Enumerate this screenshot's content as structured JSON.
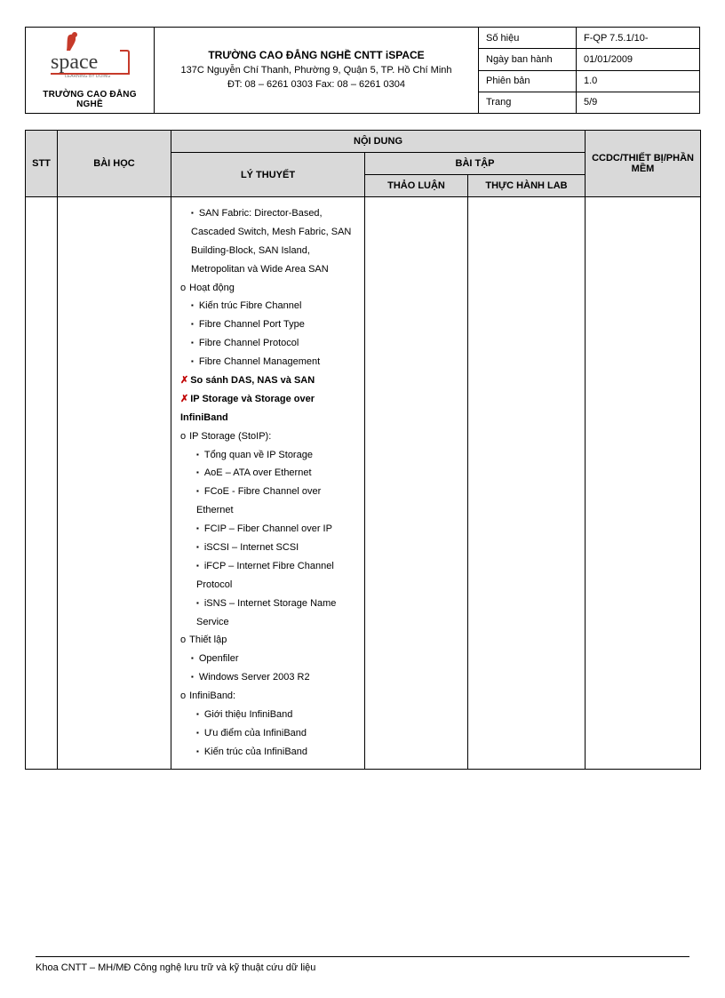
{
  "logo": {
    "word": "space",
    "subtitle": "TRƯỜNG CAO ĐẲNG NGHỀ"
  },
  "header": {
    "title": "TRƯỜNG CAO ĐẲNG NGHỀ CNTT iSPACE",
    "address": "137C Nguyễn Chí Thanh, Phường 9, Quận 5, TP. Hồ Chí Minh",
    "contact": "ĐT: 08 – 6261 0303    Fax: 08 – 6261 0304"
  },
  "info": {
    "sohieu_label": "Số hiệu",
    "sohieu_val": "F-QP 7.5.1/10-",
    "ngay_label": "Ngày ban hành",
    "ngay_val": "01/01/2009",
    "phienban_label": "Phiên bản",
    "phienban_val": "1.0",
    "trang_label": "Trang",
    "trang_val": "5/9"
  },
  "columns": {
    "stt": "STT",
    "baihoc": "BÀI HỌC",
    "noidung": "NỘI DUNG",
    "lythuyet": "LÝ THUYẾT",
    "baitap": "BÀI TẬP",
    "thaoluan": "THẢO LUẬN",
    "lab": "THỰC HÀNH LAB",
    "ccdc": "CCDC/THIẾT BỊ/PHẦN MỀM"
  },
  "content": {
    "l1": "SAN Fabric: Director-Based, Cascaded Switch, Mesh Fabric, SAN Building-Block, SAN Island, Metropolitan và Wide Area SAN",
    "l2": "Hoạt động",
    "l3": "Kiến trúc Fibre Channel",
    "l4": "Fibre Channel Port Type",
    "l5": "Fibre Channel Protocol",
    "l6": "Fibre Channel Management",
    "l7": "So sánh DAS, NAS và SAN",
    "l8": "IP Storage và Storage over InfiniBand",
    "l9": "IP Storage (StoIP):",
    "l10": "Tổng quan về IP Storage",
    "l11": "AoE – ATA over Ethernet",
    "l12": "FCoE - Fibre Channel over Ethernet",
    "l13": "FCIP – Fiber Channel over IP",
    "l14": "iSCSI – Internet SCSI",
    "l15": "iFCP – Internet Fibre Channel Protocol",
    "l16": "iSNS – Internet Storage Name Service",
    "l17": "Thiết lập",
    "l18": "Openfiler",
    "l19": "Windows Server 2003 R2",
    "l20": "InfiniBand:",
    "l21": "Giới thiệu InfiniBand",
    "l22": "Ưu điểm của InfiniBand",
    "l23": "Kiến trúc của InfiniBand"
  },
  "footer": "Khoa CNTT – MH/MĐ Công nghệ lưu trữ và kỹ thuật cứu dữ liệu"
}
